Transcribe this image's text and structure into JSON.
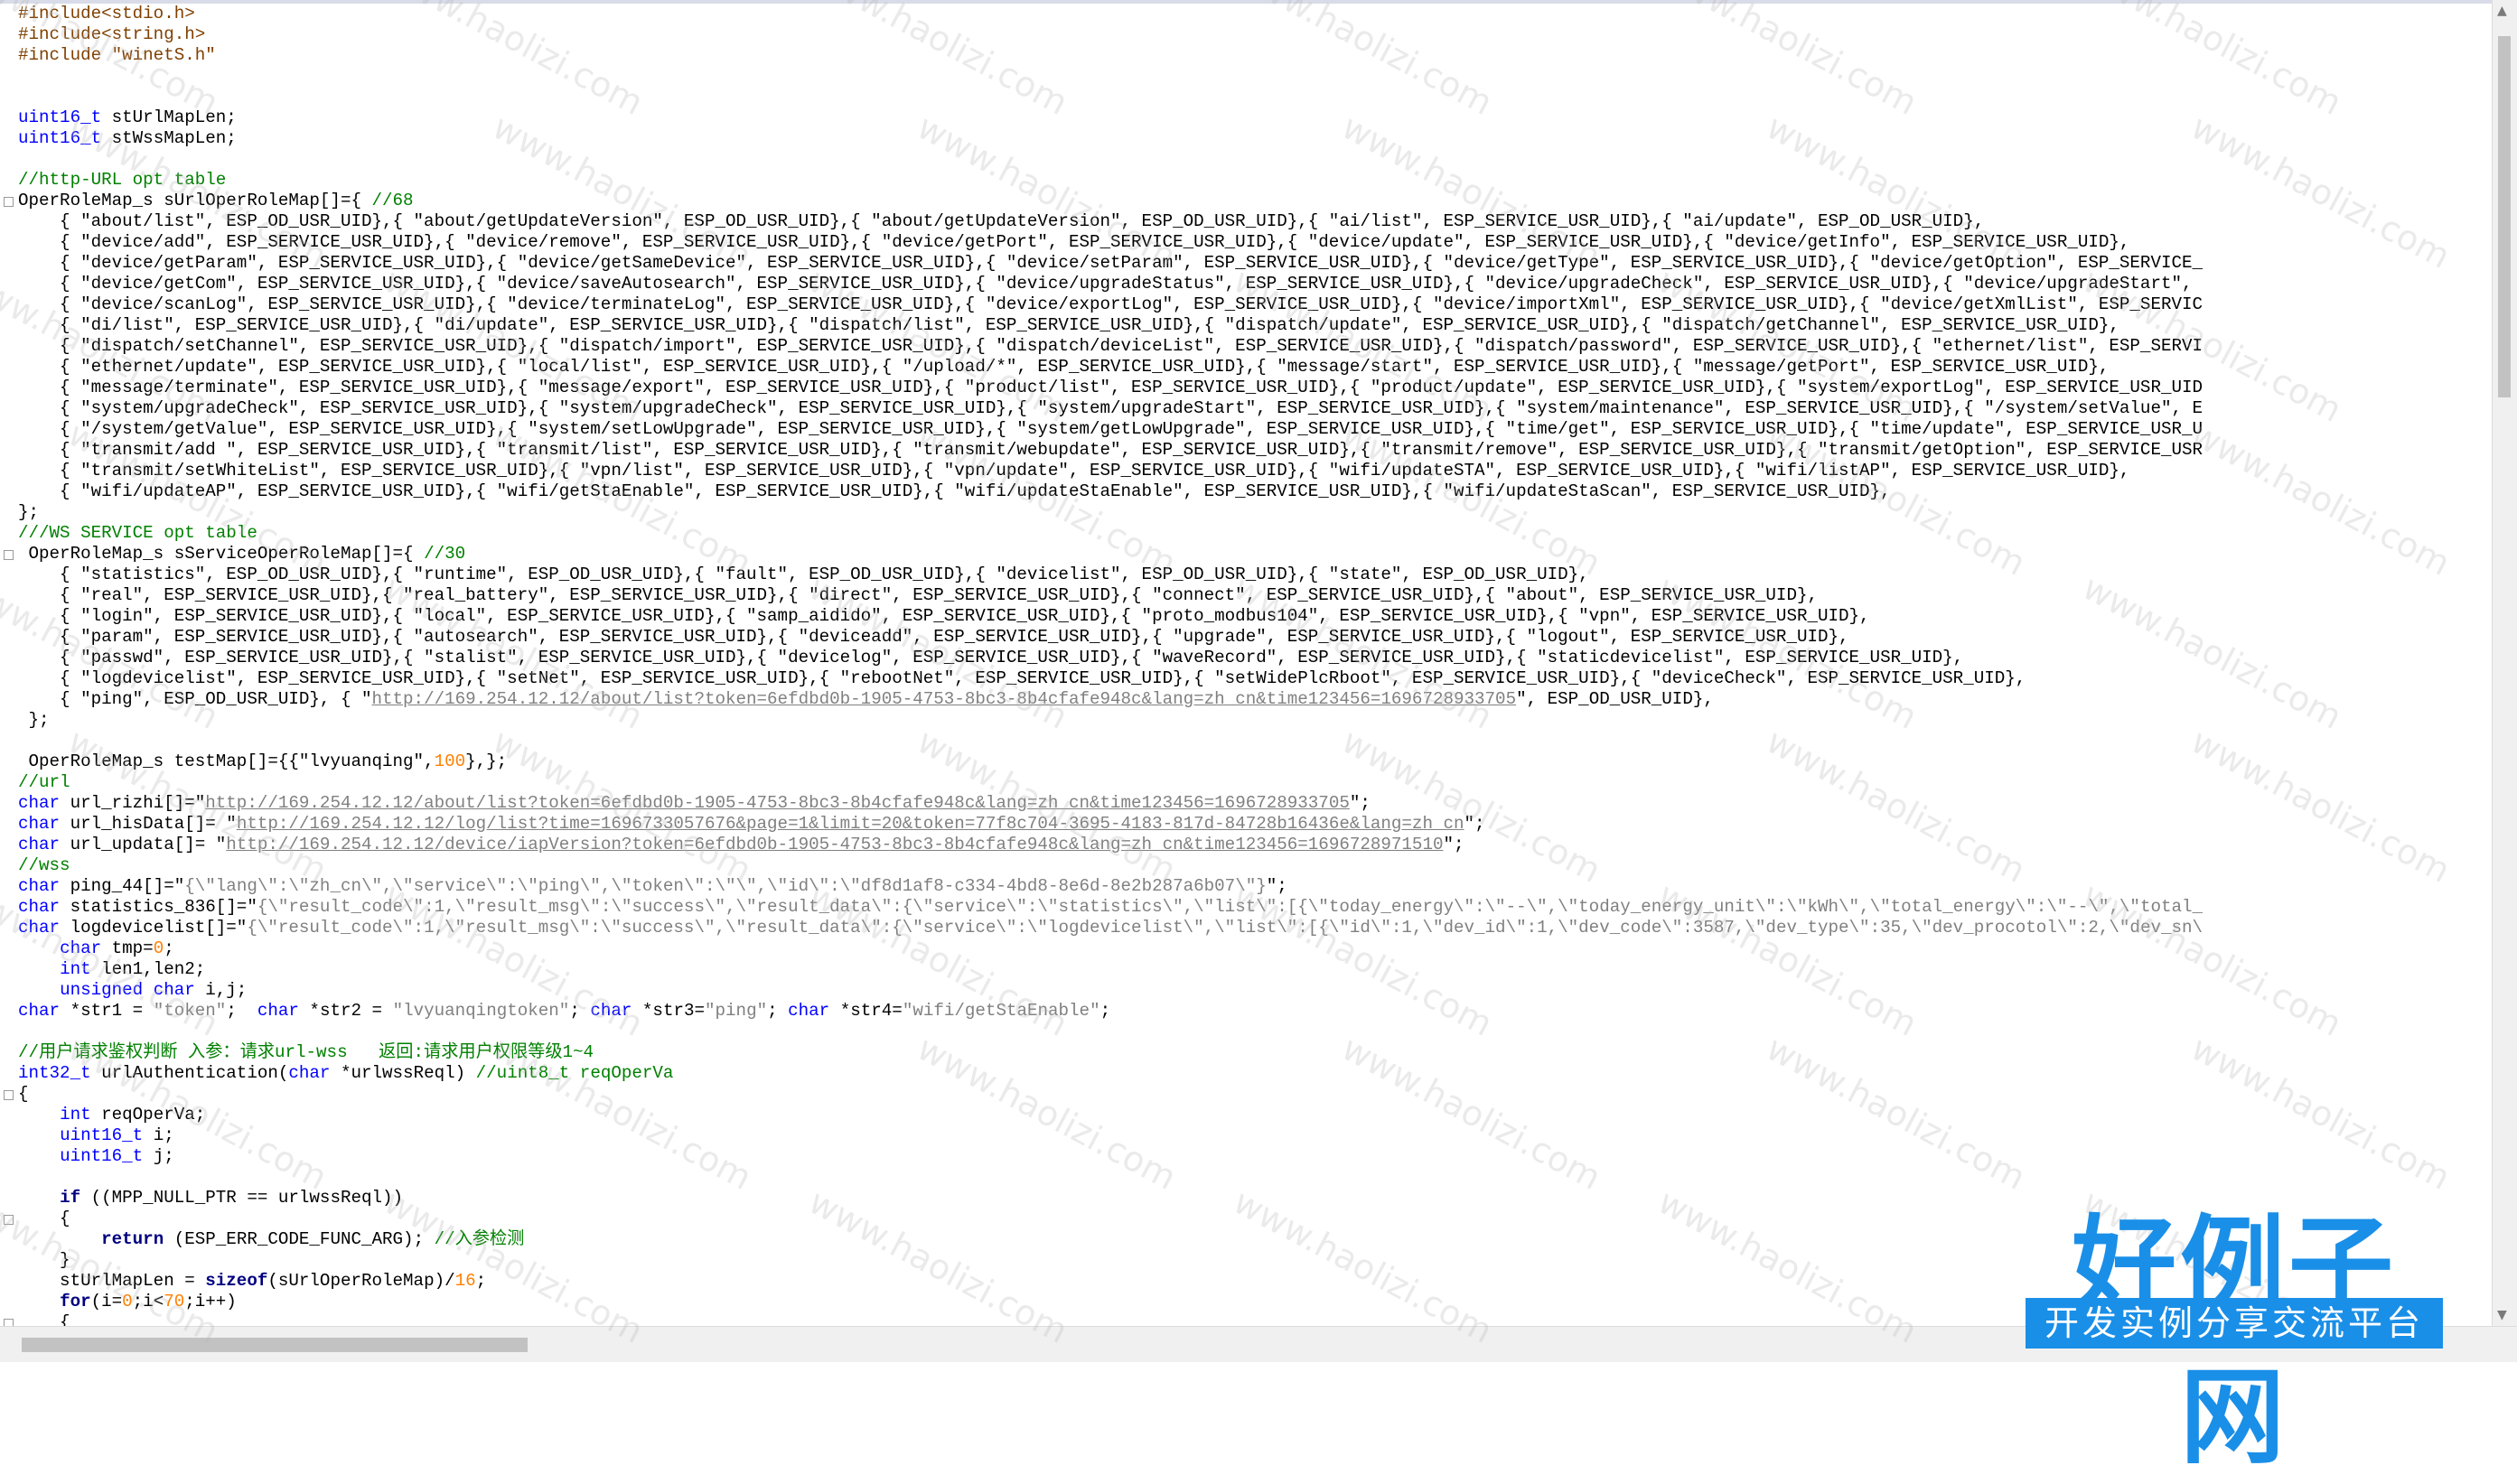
{
  "colors": {
    "preprocessor": "#804000",
    "comment": "#008000",
    "keyword": "#0000ff",
    "bold_keyword": "#000080",
    "string": "#808080",
    "number": "#ff8000",
    "logo_blue": "#1a8fe8"
  },
  "watermark": {
    "text": "www.haolizi.com"
  },
  "logo": {
    "title": "好例子网",
    "subtitle": "开发实例分享交流平台"
  },
  "code": {
    "l01": "#include<stdio.h>",
    "l02": "#include<string.h>",
    "l03": "#include \"winetS.h\"",
    "l06_type": "uint16_t",
    "l06_rest": " stUrlMapLen;",
    "l07_type": "uint16_t",
    "l07_rest": " stWssMapLen;",
    "l09": "//http-URL opt table",
    "l10_a": "OperRoleMap_s sUrlOperRoleMap[]={ ",
    "l10_c": "//68",
    "l11": "    { \"about/list\", ESP_OD_USR_UID},{ \"about/getUpdateVersion\", ESP_OD_USR_UID},{ \"about/getUpdateVersion\", ESP_OD_USR_UID},{ \"ai/list\", ESP_SERVICE_USR_UID},{ \"ai/update\", ESP_OD_USR_UID},",
    "l12": "    { \"device/add\", ESP_SERVICE_USR_UID},{ \"device/remove\", ESP_SERVICE_USR_UID},{ \"device/getPort\", ESP_SERVICE_USR_UID},{ \"device/update\", ESP_SERVICE_USR_UID},{ \"device/getInfo\", ESP_SERVICE_USR_UID},",
    "l13": "    { \"device/getParam\", ESP_SERVICE_USR_UID},{ \"device/getSameDevice\", ESP_SERVICE_USR_UID},{ \"device/setParam\", ESP_SERVICE_USR_UID},{ \"device/getType\", ESP_SERVICE_USR_UID},{ \"device/getOption\", ESP_SERVICE_",
    "l14": "    { \"device/getCom\", ESP_SERVICE_USR_UID},{ \"device/saveAutosearch\", ESP_SERVICE_USR_UID},{ \"device/upgradeStatus\", ESP_SERVICE_USR_UID},{ \"device/upgradeCheck\", ESP_SERVICE_USR_UID},{ \"device/upgradeStart\",",
    "l15": "    { \"device/scanLog\", ESP_SERVICE_USR_UID},{ \"device/terminateLog\", ESP_SERVICE_USR_UID},{ \"device/exportLog\", ESP_SERVICE_USR_UID},{ \"device/importXml\", ESP_SERVICE_USR_UID},{ \"device/getXmlList\", ESP_SERVIC",
    "l16": "    { \"di/list\", ESP_SERVICE_USR_UID},{ \"di/update\", ESP_SERVICE_USR_UID},{ \"dispatch/list\", ESP_SERVICE_USR_UID},{ \"dispatch/update\", ESP_SERVICE_USR_UID},{ \"dispatch/getChannel\", ESP_SERVICE_USR_UID},",
    "l17": "    { \"dispatch/setChannel\", ESP_SERVICE_USR_UID},{ \"dispatch/import\", ESP_SERVICE_USR_UID},{ \"dispatch/deviceList\", ESP_SERVICE_USR_UID},{ \"dispatch/password\", ESP_SERVICE_USR_UID},{ \"ethernet/list\", ESP_SERVI",
    "l18": "    { \"ethernet/update\", ESP_SERVICE_USR_UID},{ \"local/list\", ESP_SERVICE_USR_UID},{ \"/upload/*\", ESP_SERVICE_USR_UID},{ \"message/start\", ESP_SERVICE_USR_UID},{ \"message/getPort\", ESP_SERVICE_USR_UID},",
    "l19": "    { \"message/terminate\", ESP_SERVICE_USR_UID},{ \"message/export\", ESP_SERVICE_USR_UID},{ \"product/list\", ESP_SERVICE_USR_UID},{ \"product/update\", ESP_SERVICE_USR_UID},{ \"system/exportLog\", ESP_SERVICE_USR_UID",
    "l20": "    { \"system/upgradeCheck\", ESP_SERVICE_USR_UID},{ \"system/upgradeCheck\", ESP_SERVICE_USR_UID},{ \"system/upgradeStart\", ESP_SERVICE_USR_UID},{ \"system/maintenance\", ESP_SERVICE_USR_UID},{ \"/system/setValue\", E",
    "l21": "    { \"/system/getValue\", ESP_SERVICE_USR_UID},{ \"system/setLowUpgrade\", ESP_SERVICE_USR_UID},{ \"system/getLowUpgrade\", ESP_SERVICE_USR_UID},{ \"time/get\", ESP_SERVICE_USR_UID},{ \"time/update\", ESP_SERVICE_USR_U",
    "l22": "    { \"transmit/add \", ESP_SERVICE_USR_UID},{ \"transmit/list\", ESP_SERVICE_USR_UID},{ \"transmit/webupdate\", ESP_SERVICE_USR_UID},{ \"transmit/remove\", ESP_SERVICE_USR_UID},{ \"transmit/getOption\", ESP_SERVICE_USR",
    "l23": "    { \"transmit/setWhiteList\", ESP_SERVICE_USR_UID},{ \"vpn/list\", ESP_SERVICE_USR_UID},{ \"vpn/update\", ESP_SERVICE_USR_UID},{ \"wifi/updateSTA\", ESP_SERVICE_USR_UID},{ \"wifi/listAP\", ESP_SERVICE_USR_UID},",
    "l24": "    { \"wifi/updateAP\", ESP_SERVICE_USR_UID},{ \"wifi/getStaEnable\", ESP_SERVICE_USR_UID},{ \"wifi/updateStaEnable\", ESP_SERVICE_USR_UID},{ \"wifi/updateStaScan\", ESP_SERVICE_USR_UID},",
    "l25": "};",
    "l26": "///WS SERVICE opt table",
    "l27_a": " OperRoleMap_s sServiceOperRoleMap[]={ ",
    "l27_c": "//30",
    "l28": "    { \"statistics\", ESP_OD_USR_UID},{ \"runtime\", ESP_OD_USR_UID},{ \"fault\", ESP_OD_USR_UID},{ \"devicelist\", ESP_OD_USR_UID},{ \"state\", ESP_OD_USR_UID},",
    "l29": "    { \"real\", ESP_SERVICE_USR_UID},{ \"real_battery\", ESP_SERVICE_USR_UID},{ \"direct\", ESP_SERVICE_USR_UID},{ \"connect\", ESP_SERVICE_USR_UID},{ \"about\", ESP_SERVICE_USR_UID},",
    "l30": "    { \"login\", ESP_SERVICE_USR_UID},{ \"local\", ESP_SERVICE_USR_UID},{ \"samp_aidido\", ESP_SERVICE_USR_UID},{ \"proto_modbus104\", ESP_SERVICE_USR_UID},{ \"vpn\", ESP_SERVICE_USR_UID},",
    "l31": "    { \"param\", ESP_SERVICE_USR_UID},{ \"autosearch\", ESP_SERVICE_USR_UID},{ \"deviceadd\", ESP_SERVICE_USR_UID},{ \"upgrade\", ESP_SERVICE_USR_UID},{ \"logout\", ESP_SERVICE_USR_UID},",
    "l32": "    { \"passwd\", ESP_SERVICE_USR_UID},{ \"stalist\", ESP_SERVICE_USR_UID},{ \"devicelog\", ESP_SERVICE_USR_UID},{ \"waveRecord\", ESP_SERVICE_USR_UID},{ \"staticdevicelist\", ESP_SERVICE_USR_UID},",
    "l33": "    { \"logdevicelist\", ESP_SERVICE_USR_UID},{ \"setNet\", ESP_SERVICE_USR_UID},{ \"rebootNet\", ESP_SERVICE_USR_UID},{ \"setWidePlcRboot\", ESP_SERVICE_USR_UID},{ \"deviceCheck\", ESP_SERVICE_USR_UID},",
    "l34_a": "    { \"ping\", ESP_OD_USR_UID}, { \"",
    "l34_link": "http://169.254.12.12/about/list?token=6efdbd0b-1905-4753-8bc3-8b4cfafe948c&lang=zh_cn&time123456=1696728933705",
    "l34_b": "\", ESP_OD_USR_UID},",
    "l35": " };",
    "l37_a": " OperRoleMap_s testMap[]={{\"lvyuanqing\",",
    "l37_num": "100",
    "l37_b": "},};",
    "l38": "//url",
    "l39_kw": "char",
    "l39_a": " url_rizhi[]=\"",
    "l39_link": "http://169.254.12.12/about/list?token=6efdbd0b-1905-4753-8bc3-8b4cfafe948c&lang=zh_cn&time123456=1696728933705",
    "l39_b": "\";",
    "l40_kw": "char",
    "l40_a": " url_hisData[]= \"",
    "l40_link": "http://169.254.12.12/log/list?time=1696733057676&page=1&limit=20&token=77f8c704-3695-4183-817d-84728b16436e&lang=zh_cn",
    "l40_b": "\";",
    "l41_kw": "char",
    "l41_a": " url_updata[]= \"",
    "l41_link": "http://169.254.12.12/device/iapVersion?token=6efdbd0b-1905-4753-8bc3-8b4cfafe948c&lang=zh_cn&time123456=1696728971510",
    "l41_b": "\";",
    "l42": "//wss",
    "l43_kw": "char",
    "l43_a": " ping_44[]=\"",
    "l43_str": "{\\\"lang\\\":\\\"zh_cn\\\",\\\"service\\\":\\\"ping\\\",\\\"token\\\":\\\"\\\",\\\"id\\\":\\\"df8d1af8-c334-4bd8-8e6d-8e2b287a6b07\\\"}",
    "l43_b": "\";",
    "l44_kw": "char",
    "l44_a": " statistics_836[]=\"",
    "l44_str": "{\\\"result_code\\\":1,\\\"result_msg\\\":\\\"success\\\",\\\"result_data\\\":{\\\"service\\\":\\\"statistics\\\",\\\"list\\\":[{\\\"today_energy\\\":\\\"--\\\",\\\"today_energy_unit\\\":\\\"kWh\\\",\\\"total_energy\\\":\\\"--\\\",\\\"total_",
    "l45_kw": "char",
    "l45_a": " logdevicelist[]=\"",
    "l45_str": "{\\\"result_code\\\":1,\\\"result_msg\\\":\\\"success\\\",\\\"result_data\\\":{\\\"service\\\":\\\"logdevicelist\\\",\\\"list\\\":[{\\\"id\\\":1,\\\"dev_id\\\":1,\\\"dev_code\\\":3587,\\\"dev_type\\\":35,\\\"dev_procotol\\\":2,\\\"dev_sn\\",
    "l46_kw": "char",
    "l46_a": " tmp=",
    "l46_num": "0",
    "l46_b": ";",
    "l47_kw": "int",
    "l47_a": " len1,len2;",
    "l48_kw": "unsigned char",
    "l48_a": " i,j;",
    "l49_kw1": "char",
    "l49_a": " *str1 = ",
    "l49_s1": "\"token\"",
    "l49_b": ";  ",
    "l49_kw2": "char",
    "l49_c": " *str2 = ",
    "l49_s2": "\"lvyuanqingtoken\"",
    "l49_d": "; ",
    "l49_kw3": "char",
    "l49_e": " *str3=",
    "l49_s3": "\"ping\"",
    "l49_f": "; ",
    "l49_kw4": "char",
    "l49_g": " *str4=",
    "l49_s4": "\"wifi/getStaEnable\"",
    "l49_h": ";",
    "l51": "//用户请求鉴权判断 入参：请求url-wss   返回:请求用户权限等级1~4",
    "l52_kw": "int32_t",
    "l52_a": " urlAuthentication(",
    "l52_kw2": "char",
    "l52_b": " *urlwssReql) ",
    "l52_c": "//uint8_t reqOperVa",
    "l53": "{",
    "l54_kw": "int",
    "l54_a": " reqOperVa;",
    "l55_kw": "uint16_t",
    "l55_a": " i;",
    "l56_kw": "uint16_t",
    "l56_a": " j;",
    "l58_kw": "if",
    "l58_a": " ((MPP_NULL_PTR == urlwssReql))",
    "l59": "    {",
    "l60_kw": "return",
    "l60_a": " (ESP_ERR_CODE_FUNC_ARG); ",
    "l60_c": "//入参检测",
    "l61": "    }",
    "l62_a": "    stUrlMapLen = ",
    "l62_kw": "sizeof",
    "l62_b": "(sUrlOperRoleMap)/",
    "l62_num": "16",
    "l62_c": ";",
    "l63_kw": "for",
    "l63_a": "(i=",
    "l63_n1": "0",
    "l63_b": ";i<",
    "l63_n2": "70",
    "l63_c": ";i++)",
    "l64": "    {"
  }
}
